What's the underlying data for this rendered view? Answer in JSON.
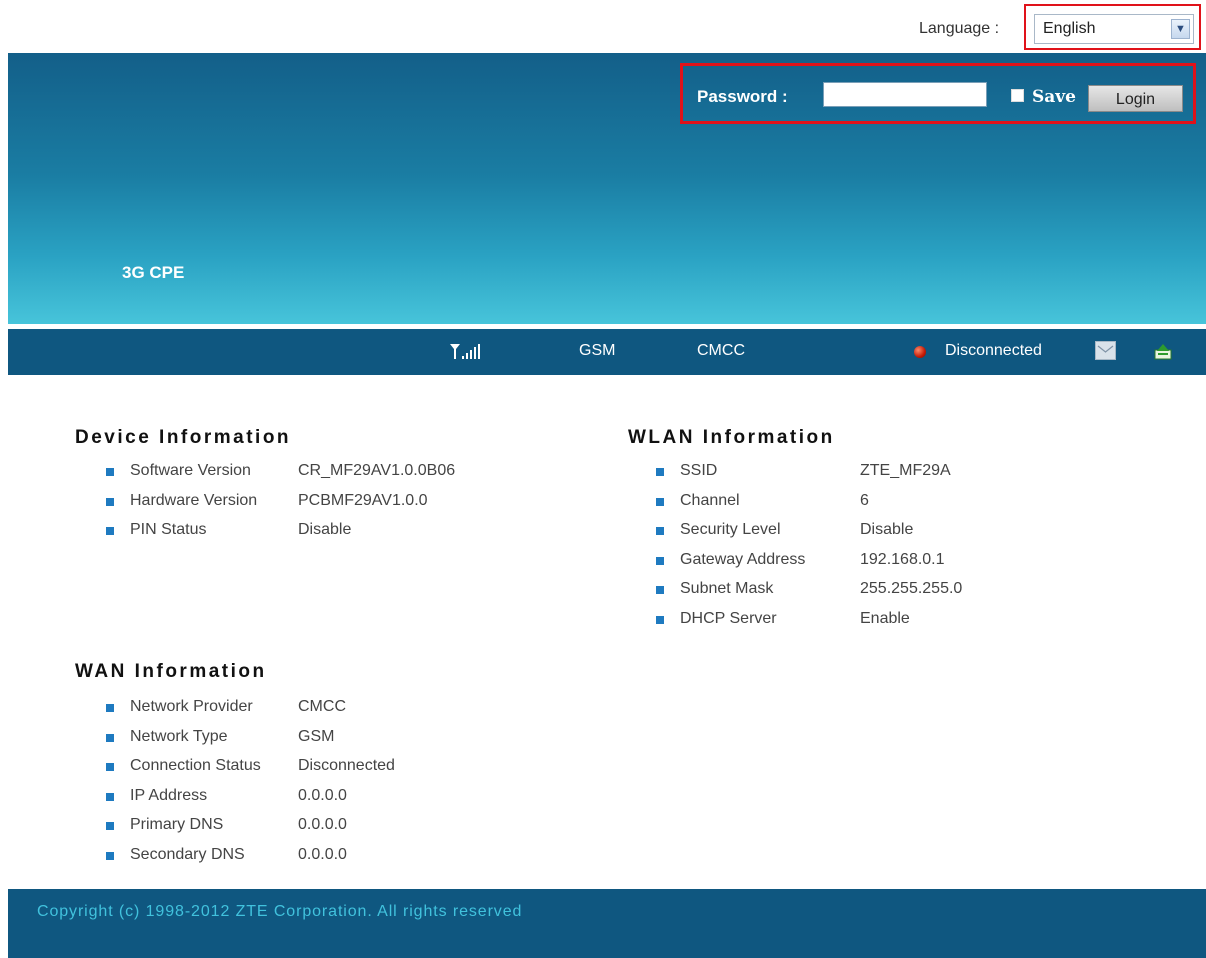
{
  "language": {
    "label": "Language :",
    "selected": "English"
  },
  "login": {
    "password_label": "Password :",
    "save_label": "Save",
    "login_button": "Login"
  },
  "banner": {
    "product": "3G CPE"
  },
  "status": {
    "network_type": "GSM",
    "provider": "CMCC",
    "connection": "Disconnected"
  },
  "device": {
    "title": "Device Information",
    "rows": [
      {
        "label": "Software Version",
        "value": "CR_MF29AV1.0.0B06"
      },
      {
        "label": "Hardware Version",
        "value": "PCBMF29AV1.0.0"
      },
      {
        "label": "PIN Status",
        "value": "Disable"
      }
    ]
  },
  "wlan": {
    "title": "WLAN Information",
    "rows": [
      {
        "label": "SSID",
        "value": "ZTE_MF29A"
      },
      {
        "label": "Channel",
        "value": "6"
      },
      {
        "label": "Security Level",
        "value": "Disable"
      },
      {
        "label": "Gateway Address",
        "value": "192.168.0.1"
      },
      {
        "label": "Subnet Mask",
        "value": "255.255.255.0"
      },
      {
        "label": "DHCP Server",
        "value": "Enable"
      }
    ]
  },
  "wan": {
    "title": "WAN Information",
    "rows": [
      {
        "label": "Network Provider",
        "value": "CMCC"
      },
      {
        "label": "Network Type",
        "value": "GSM"
      },
      {
        "label": "Connection Status",
        "value": "Disconnected"
      },
      {
        "label": "IP Address",
        "value": "0.0.0.0"
      },
      {
        "label": "Primary DNS",
        "value": "0.0.0.0"
      },
      {
        "label": "Secondary DNS",
        "value": "0.0.0.0"
      }
    ]
  },
  "footer": {
    "copyright": "Copyright (c) 1998-2012 ZTE Corporation. All rights reserved"
  }
}
